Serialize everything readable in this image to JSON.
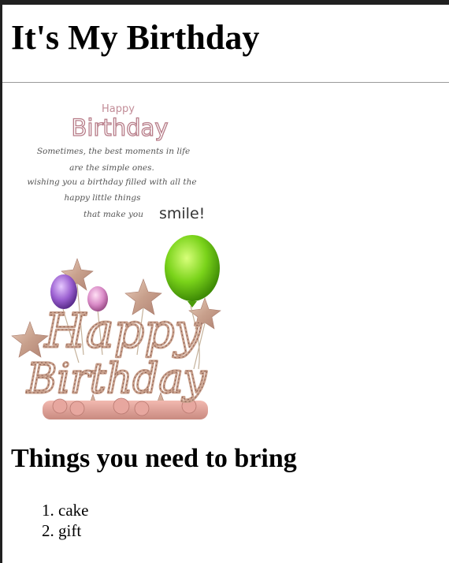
{
  "page": {
    "heading": "It's My Birthday",
    "subheading": "Things you need to bring",
    "items": [
      "cake",
      "gift"
    ]
  },
  "card": {
    "happy": "Happy",
    "birthday": "Birthday",
    "quote_lines": [
      "Sometimes, the best moments in life",
      "are the simple ones.",
      "wishing you a birthday filled with all the",
      "happy little things",
      "that make you"
    ],
    "smile": "smile!",
    "topper_line1": "Happy",
    "topper_line2": "Birthday"
  }
}
